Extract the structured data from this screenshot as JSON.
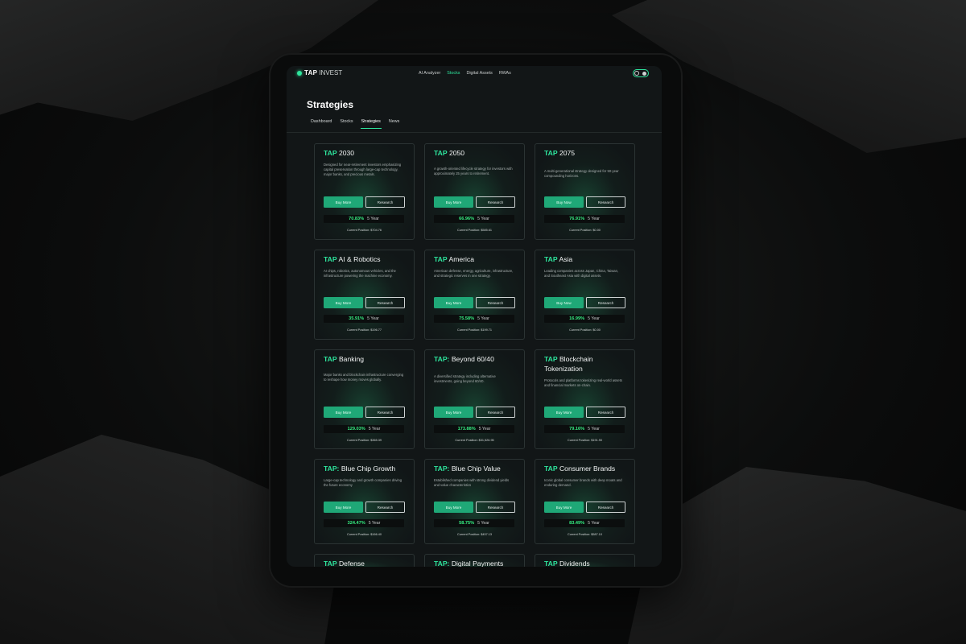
{
  "app": {
    "logo_tap": "TAP",
    "logo_invest": "INVEST",
    "nav": [
      "AI Analyzer",
      "Stocks",
      "Digital Assets",
      "RWAs"
    ],
    "nav_active": "Stocks",
    "page_title": "Strategies",
    "subtabs": [
      "Dashboard",
      "Stocks",
      "Strategies",
      "News"
    ],
    "subtab_active": "Strategies",
    "accent_color": "#2ee59d",
    "icons": {
      "logo": "logo-dot-icon",
      "toggle": "theme-toggle-icon"
    }
  },
  "strategies": [
    {
      "prefix": "TAP",
      "name": "2030",
      "desc": "Designed for near-retirement investors emphasizing capital preservation through large-cap technology, major banks, and precious metals.",
      "buy": "Buy More",
      "research": "Research",
      "pct": "70.83%",
      "term": "5 Year",
      "position": "Current Position: $704.76"
    },
    {
      "prefix": "TAP",
      "name": "2050",
      "desc": "A growth-oriented lifecycle strategy for investors with approximately 25 years to retirement.",
      "buy": "Buy More",
      "research": "Research",
      "pct": "66.96%",
      "term": "5 Year",
      "position": "Current Position: $585.61"
    },
    {
      "prefix": "TAP",
      "name": "2075",
      "desc": "A multi-generational strategy designed for 50-year compounding horizons.",
      "buy": "Buy Now",
      "research": "Research",
      "pct": "76.91%",
      "term": "5 Year",
      "position": "Current Position: $0.00"
    },
    {
      "prefix": "TAP",
      "name": "AI & Robotics",
      "desc": "AI chips, robotics, autonomous vehicles, and the infrastructure powering the machine economy.",
      "buy": "Buy More",
      "research": "Research",
      "pct": "35.91%",
      "term": "5 Year",
      "position": "Current Position: $196.77"
    },
    {
      "prefix": "TAP",
      "name": "America",
      "desc": "American defense, energy, agriculture, infrastructure, and strategic reserves in one strategy.",
      "buy": "Buy More",
      "research": "Research",
      "pct": "75.58%",
      "term": "5 Year",
      "position": "Current Position: $199.71"
    },
    {
      "prefix": "TAP",
      "name": "Asia",
      "desc": "Leading companies across Japan, China, Taiwan, and Southeast Asia with digital assets.",
      "buy": "Buy Now",
      "research": "Research",
      "pct": "16.99%",
      "term": "5 Year",
      "position": "Current Position: $0.00"
    },
    {
      "prefix": "TAP",
      "name": "Banking",
      "desc": "Major banks and blockchain infrastructure converging to reshape how money moves globally.",
      "buy": "Buy More",
      "research": "Research",
      "pct": "129.03%",
      "term": "5 Year",
      "position": "Current Position: $365.39"
    },
    {
      "prefix": "TAP:",
      "name": "Beyond 60/40",
      "desc": "A diversified strategy including alternative investments, going beyond 60/40.",
      "buy": "Buy More",
      "research": "Research",
      "pct": "173.88%",
      "term": "5 Year",
      "position": "Current Position: $31,526.95"
    },
    {
      "prefix": "TAP",
      "name": "Blockchain Tokenization",
      "desc": "Protocols and platforms tokenizing real-world assets and financial markets on-chain.",
      "buy": "Buy More",
      "research": "Research",
      "pct": "79.16%",
      "term": "5 Year",
      "position": "Current Position: $191.90"
    },
    {
      "prefix": "TAP:",
      "name": "Blue Chip Growth",
      "desc": "Large-cap technology and growth companies driving the future economy",
      "buy": "Buy More",
      "research": "Research",
      "pct": "324.47%",
      "term": "5 Year",
      "position": "Current Position: $166.40"
    },
    {
      "prefix": "TAP:",
      "name": "Blue Chip Value",
      "desc": "Established companies with strong dividend yields and value characteristics",
      "buy": "Buy More",
      "research": "Research",
      "pct": "58.75%",
      "term": "5 Year",
      "position": "Current Position: $457.13"
    },
    {
      "prefix": "TAP",
      "name": "Consumer Brands",
      "desc": "Iconic global consumer brands with deep moats and enduring demand.",
      "buy": "Buy More",
      "research": "Research",
      "pct": "83.49%",
      "term": "5 Year",
      "position": "Current Position: $587.10"
    },
    {
      "prefix": "TAP",
      "name": "Defense"
    },
    {
      "prefix": "TAP:",
      "name": "Digital Payments"
    },
    {
      "prefix": "TAP",
      "name": "Dividends"
    }
  ]
}
